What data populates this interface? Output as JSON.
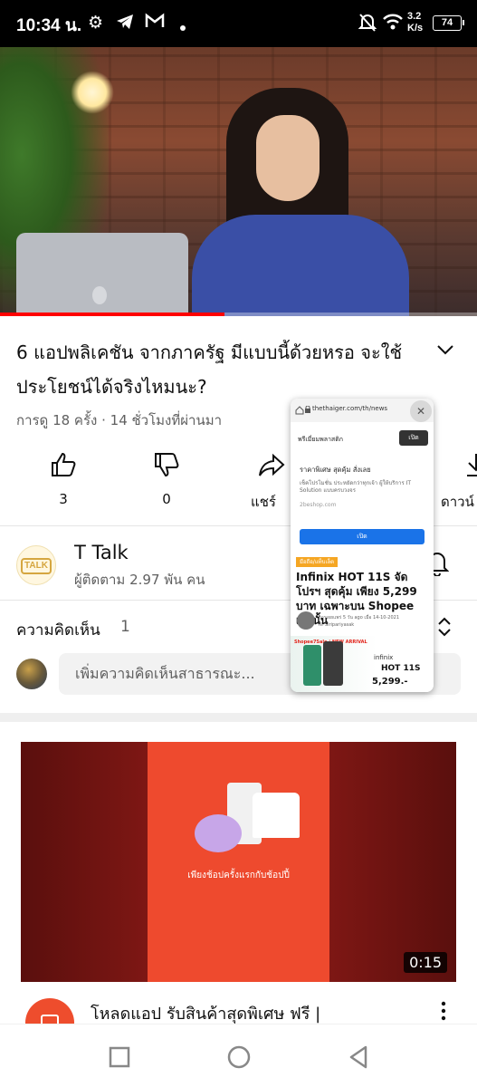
{
  "status_bar": {
    "time": "10:34 น.",
    "network_speed_value": "3.2",
    "network_speed_unit": "K/s",
    "battery": "74",
    "icons": [
      "gear-icon",
      "telegram-icon",
      "gmail-icon",
      "dot-icon",
      "mute-bell-icon",
      "wifi-icon"
    ]
  },
  "video": {
    "progress_fraction": 0.47,
    "accent_color": "#ff0000"
  },
  "details": {
    "title": "6 แอปพลิเคชัน จากภาครัฐ มีแบบนี้ด้วยหรอ จะใช้ประโยชน์ได้จริงไหมนะ?",
    "meta": "การดู 18 ครั้ง · 14 ชั่วโมงที่ผ่านมา"
  },
  "actions": {
    "like_count": "3",
    "dislike_count": "0",
    "share_label": "แชร์",
    "download_label": "ดาวน์"
  },
  "channel": {
    "avatar_text": "TALK",
    "name": "T Talk",
    "subscribers": "ผู้ติดตาม 2.97 พัน คน"
  },
  "comments": {
    "label": "ความคิดเห็น",
    "count": "1",
    "placeholder": "เพิ่มความคิดเห็นสาธารณะ..."
  },
  "ad": {
    "caption": "เพียงช้อปครั้งแรกกับช้อปปี้",
    "duration": "0:15",
    "title": "โหลดแอป รับสินค้าสุดพิเศษ ฟรี |"
  },
  "pip": {
    "url": "thethaiger.com/th/news",
    "promo_text": "พรีเมี่ยมพลาสติก",
    "open_label": "เปิด",
    "ad_heading": "ราคาพิเศษ สุดคุ้ม สั่งเลย",
    "ad_body": "เช็คโปรโมชั่น ประหยัดกว่าทุกเจ้า ผู้ให้บริการ IT Solution แบบครบวงจร",
    "ad_site": "2beshop.com",
    "ad_button": "เปิด",
    "tag": "มือถือ/แท็บเล็ต",
    "headline": "Infinix HOT 11S จัดโปรฯ สุดคุ้ม เพียง 5,299 บาท เฉพาะบน Shopee เท่านั้น",
    "byline_date": "การเผยแพร่ 5 วัน ago เมื่อ 14-10-2021",
    "byline_author": "N. Siripariyasak",
    "banner_label": "Shopee7Sale | NEW ARRIVAL",
    "banner_brand": "infinix",
    "banner_model": "HOT 11S",
    "banner_price": "5,299.-"
  }
}
